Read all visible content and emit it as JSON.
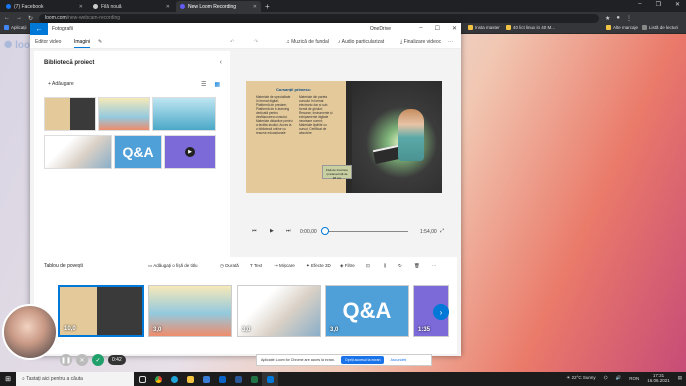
{
  "browser": {
    "tabs": [
      {
        "label": "(7) Facebook",
        "color": "#1877f2",
        "active": false
      },
      {
        "label": "Filă nouă",
        "color": "#cccccc",
        "active": false
      },
      {
        "label": "New Loom Recording",
        "color": "#625df5",
        "active": true
      }
    ],
    "new_tab": "+",
    "url_domain": "loom.com",
    "url_path": "/new-webcam-recording",
    "bookmarks": [
      "Aplicații",
      "Insta master",
      "40 lict linux in 40 M...",
      "Alte marcaje",
      "Listă de lecturi"
    ]
  },
  "photos": {
    "app_title": "Fotografii",
    "back_symbol": "←",
    "onedrive_label": "OneDrive",
    "toolbar": {
      "tab_video": "Editor video",
      "tab_images": "Imagini",
      "music": "Muzică de fundal",
      "audio": "Audio particularizat",
      "finish": "Finalizare videoc",
      "more": "···"
    },
    "library": {
      "title": "Bibliotecă proiect",
      "add": "+ Adăugare",
      "collapse": "‹"
    },
    "preview": {
      "heading": "Cursanții primesc:",
      "col1": "Materiale de specialitate în format digital; Platformă de predare; Platformă de e-learning dedicată pentru desfășurarea cursului; Materiale didactice pentru a facilita studiul; Acces la o bibliotecă online cu resurse educaționale",
      "col2": "Materiale din partea cursului în format electronic dar și sub formă de ghiduri; Resurse, instrumente și echipamente digitale necesare curent; Materiale tipărite cu cursul; Certificat de absolvire",
      "box": "Fișă de înscriere și adeverință de 48 ore"
    },
    "player": {
      "current": "0:00,00",
      "total": "1:54,00"
    },
    "storyboard": {
      "title": "Tablou de povești",
      "actions": [
        "Adăugați o fișă de titlu",
        "Durată",
        "Text",
        "Mișcare",
        "Efecte 3D",
        "Filtre"
      ],
      "clips": [
        {
          "duration": "10,0"
        },
        {
          "duration": "3,0"
        },
        {
          "duration": "3,0"
        },
        {
          "duration": "3,0"
        },
        {
          "duration": "1:35"
        }
      ]
    }
  },
  "notification": {
    "text": "Aplicație Loom for Chrome are acces la ecran.",
    "primary": "Opriți accesul la ecran",
    "secondary": "Ascundeți"
  },
  "recorder": {
    "timer": "0:42"
  },
  "taskbar": {
    "search_placeholder": "Tastați aici pentru a căuta",
    "weather": "22°C Sunny",
    "language": "RON",
    "time": "17:31",
    "date": "16.06.2021"
  }
}
